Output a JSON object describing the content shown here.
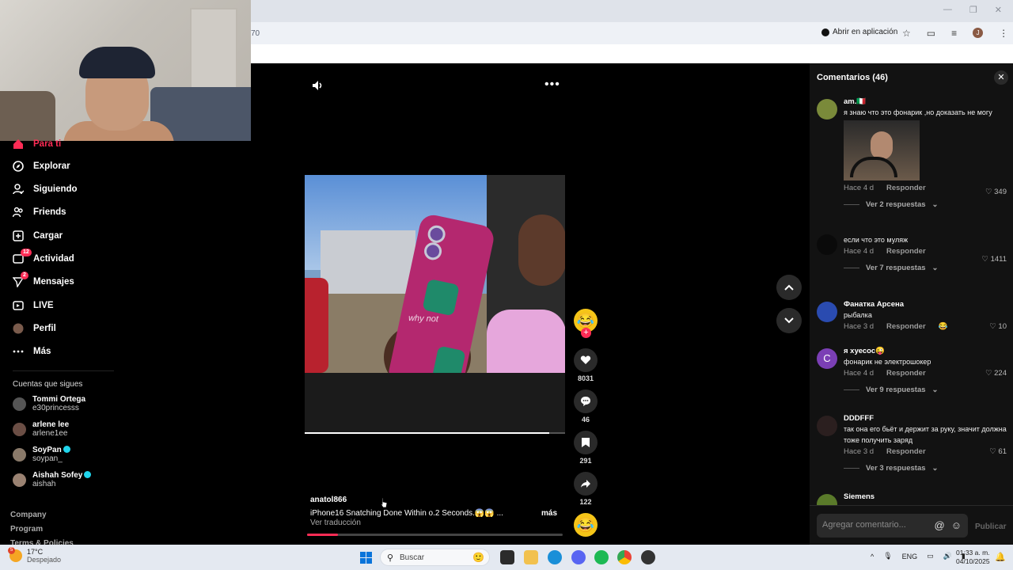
{
  "browser": {
    "url_fragment": "70",
    "open_in_app": "Abrir en aplicación",
    "profile_initial": "J"
  },
  "sidebar": {
    "items": [
      {
        "label": "Para ti",
        "icon": "home-icon"
      },
      {
        "label": "Explorar",
        "icon": "compass-icon"
      },
      {
        "label": "Siguiendo",
        "icon": "user-follow-icon"
      },
      {
        "label": "Friends",
        "icon": "friends-icon"
      },
      {
        "label": "Cargar",
        "icon": "upload-icon"
      },
      {
        "label": "Actividad",
        "icon": "inbox-icon",
        "badge": "12"
      },
      {
        "label": "Mensajes",
        "icon": "send-icon",
        "badge": "2"
      },
      {
        "label": "LIVE",
        "icon": "live-icon"
      },
      {
        "label": "Perfil",
        "icon": "avatar-icon"
      },
      {
        "label": "Más",
        "icon": "more-icon"
      }
    ],
    "following_title": "Cuentas que sigues",
    "accounts": [
      {
        "name": "Tommi Ortega",
        "handle": "e30princesss",
        "verified": false
      },
      {
        "name": "arlene lee",
        "handle": "arlene1ee",
        "verified": false
      },
      {
        "name": "SoyPan",
        "handle": "soypan_",
        "verified": true
      },
      {
        "name": "Aishah Sofey",
        "handle": "aishah",
        "verified": true
      }
    ],
    "footer": [
      "Company",
      "Program",
      "Terms & Policies"
    ]
  },
  "video": {
    "author": "anatol866",
    "caption": "iPhone16 Snatching Done Within o.2 Seconds.😱😱 ...",
    "more": "más",
    "translate": "Ver traducción",
    "phone_text": "why not",
    "progress": 0.12,
    "actions": {
      "likes": "8031",
      "comments": "46",
      "saves": "291",
      "shares": "122"
    }
  },
  "comments": {
    "title": "Comentarios (46)",
    "placeholder": "Agregar comentario...",
    "publish": "Publicar",
    "items": [
      {
        "user": "am.🇮🇹",
        "text": "я знаю что это фонарик ,но доказать не могу",
        "time": "Hace 4 d",
        "reply": "Responder",
        "likes": "349",
        "replies": "Ver 2 respuestas"
      },
      {
        "user": "",
        "text": "если что это муляж",
        "time": "Hace 4 d",
        "reply": "Responder",
        "likes": "1411",
        "replies": "Ver 7 respuestas"
      },
      {
        "user": "Фанатка Арсена",
        "text": "рыбалка",
        "time": "Hace 3 d",
        "reply": "Responder",
        "likes": "10",
        "replies": ""
      },
      {
        "user": "я хуесос😜",
        "text": "фонарик не электрошокер",
        "time": "Hace 4 d",
        "reply": "Responder",
        "likes": "224",
        "replies": "Ver 9 respuestas"
      },
      {
        "user": "DDDFFF",
        "text": "так она его бьёт и держит за руку, значит должна тоже получить заряд",
        "time": "Hace 3 d",
        "reply": "Responder",
        "likes": "61",
        "replies": "Ver 3 respuestas"
      },
      {
        "user": "Siemens",
        "text": "",
        "time": "",
        "reply": "",
        "likes": "",
        "replies": ""
      }
    ]
  },
  "taskbar": {
    "weather_temp": "17°C",
    "weather_desc": "Despejado",
    "weather_badge": "5",
    "search_label": "Buscar",
    "lang": "ENG",
    "time": "01:33 a. m.",
    "date": "04/10/2025"
  },
  "colors": {
    "accent": "#fe2c55",
    "panel": "#121212",
    "taskbar": "#e4e9f1"
  }
}
